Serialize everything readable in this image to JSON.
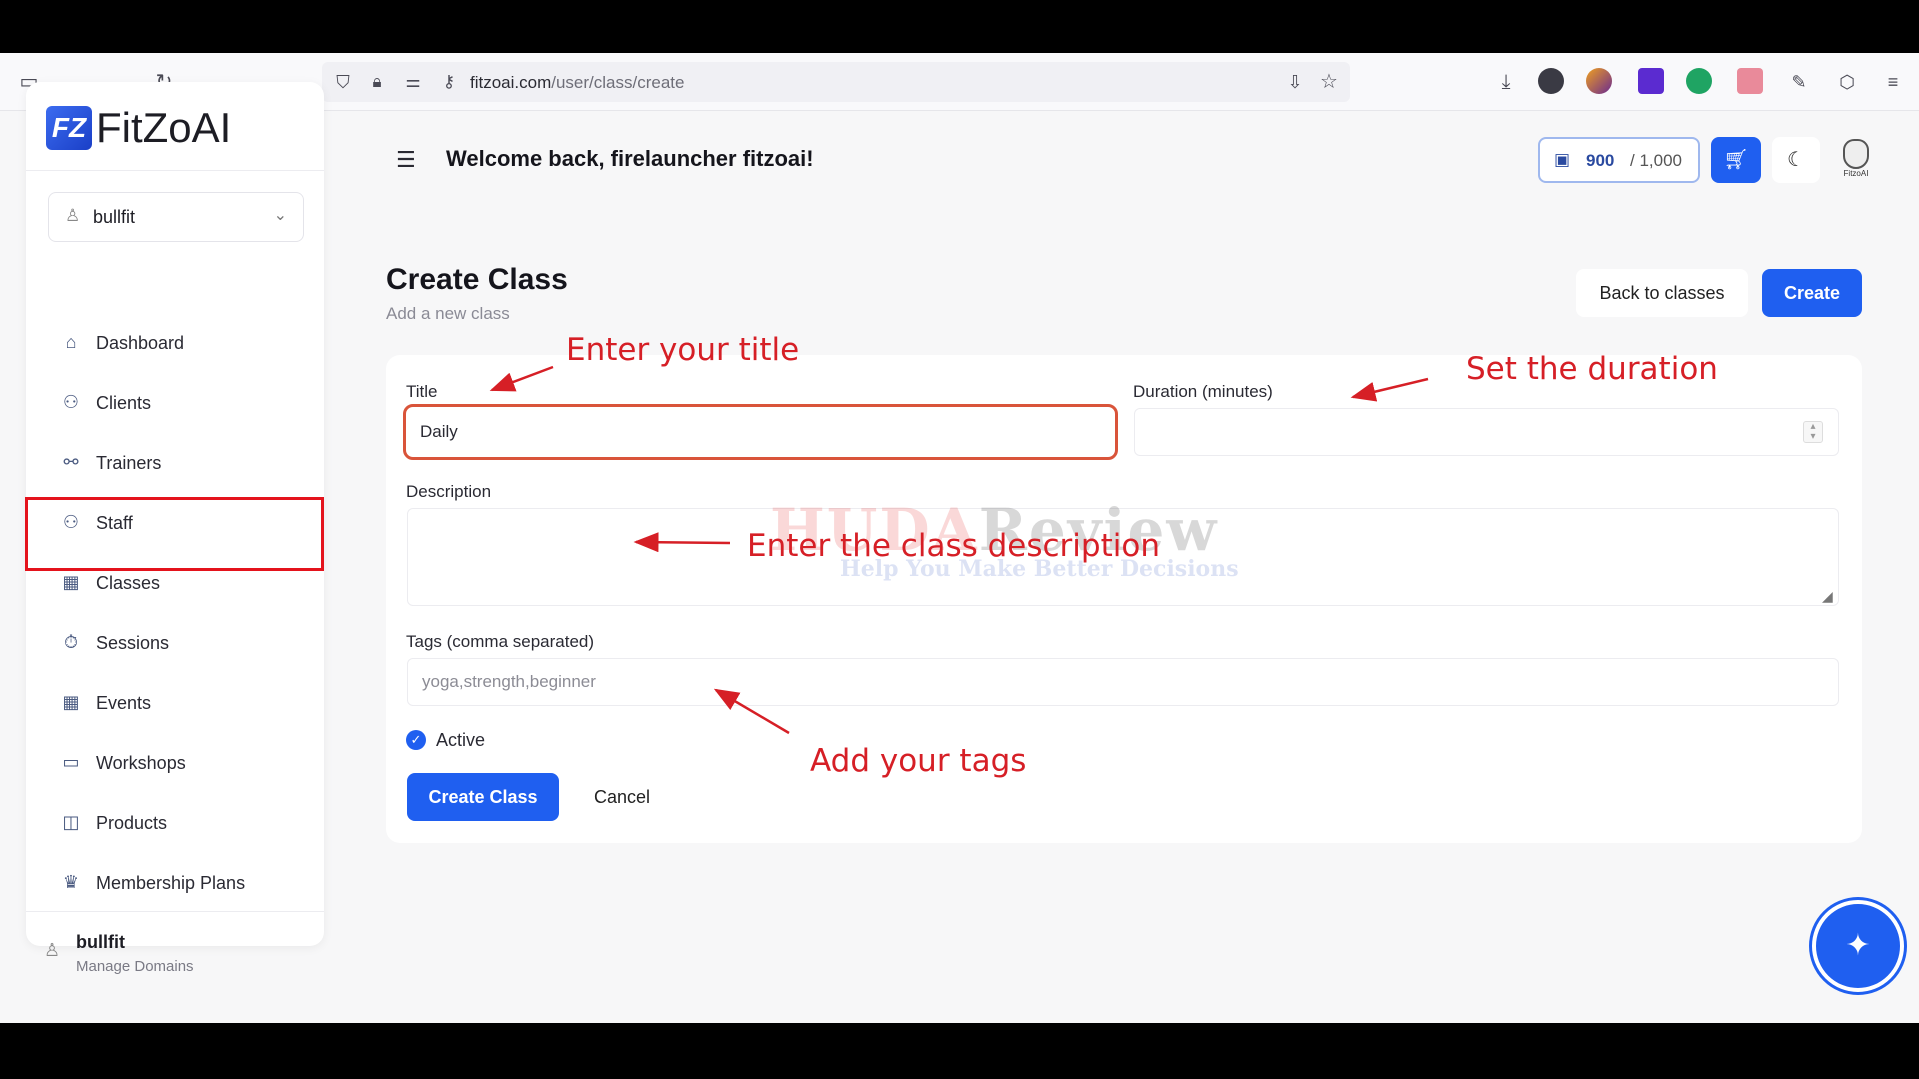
{
  "browser": {
    "url_host": "fitzoai.com",
    "url_path": "/user/class/create"
  },
  "sidebar": {
    "logo_mark": "FZ",
    "logo_text": "FitZoAI",
    "workspace": "bullfit",
    "items": [
      {
        "label": "Dashboard",
        "icon": "home-icon"
      },
      {
        "label": "Clients",
        "icon": "users-icon"
      },
      {
        "label": "Trainers",
        "icon": "trainers-icon"
      },
      {
        "label": "Staff",
        "icon": "staff-icon"
      },
      {
        "label": "Classes",
        "icon": "calendar-icon"
      },
      {
        "label": "Sessions",
        "icon": "timer-icon"
      },
      {
        "label": "Events",
        "icon": "calendar-icon"
      },
      {
        "label": "Workshops",
        "icon": "presentation-icon"
      },
      {
        "label": "Products",
        "icon": "bag-icon"
      },
      {
        "label": "Membership Plans",
        "icon": "crown-icon"
      }
    ],
    "footer": {
      "name": "bullfit",
      "subtitle": "Manage Domains"
    }
  },
  "header": {
    "welcome": "Welcome back, firelauncher fitzoai!",
    "credits_value": "900",
    "credits_max": "/ 1,000",
    "avatar_label": "FitzoAI"
  },
  "page": {
    "title": "Create Class",
    "subtitle": "Add a new class",
    "back_label": "Back to classes",
    "create_label": "Create"
  },
  "form": {
    "title_label": "Title",
    "title_value": "Daily",
    "duration_label": "Duration (minutes)",
    "duration_value": "",
    "description_label": "Description",
    "tags_label": "Tags (comma separated)",
    "tags_placeholder": "yoga,strength,beginner",
    "active_label": "Active",
    "active_checked": true,
    "submit_label": "Create Class",
    "cancel_label": "Cancel"
  },
  "annotations": {
    "title": "Enter your title",
    "duration": "Set the duration",
    "description": "Enter the class description",
    "tags": "Add your tags"
  },
  "watermark": {
    "brand_a": "HUDA",
    "brand_b": "Review",
    "tagline": "Help You Make Better Decisions"
  },
  "colors": {
    "accent": "#1f5ff0",
    "annotation": "#d61f26",
    "focus_border": "#d9543a"
  }
}
